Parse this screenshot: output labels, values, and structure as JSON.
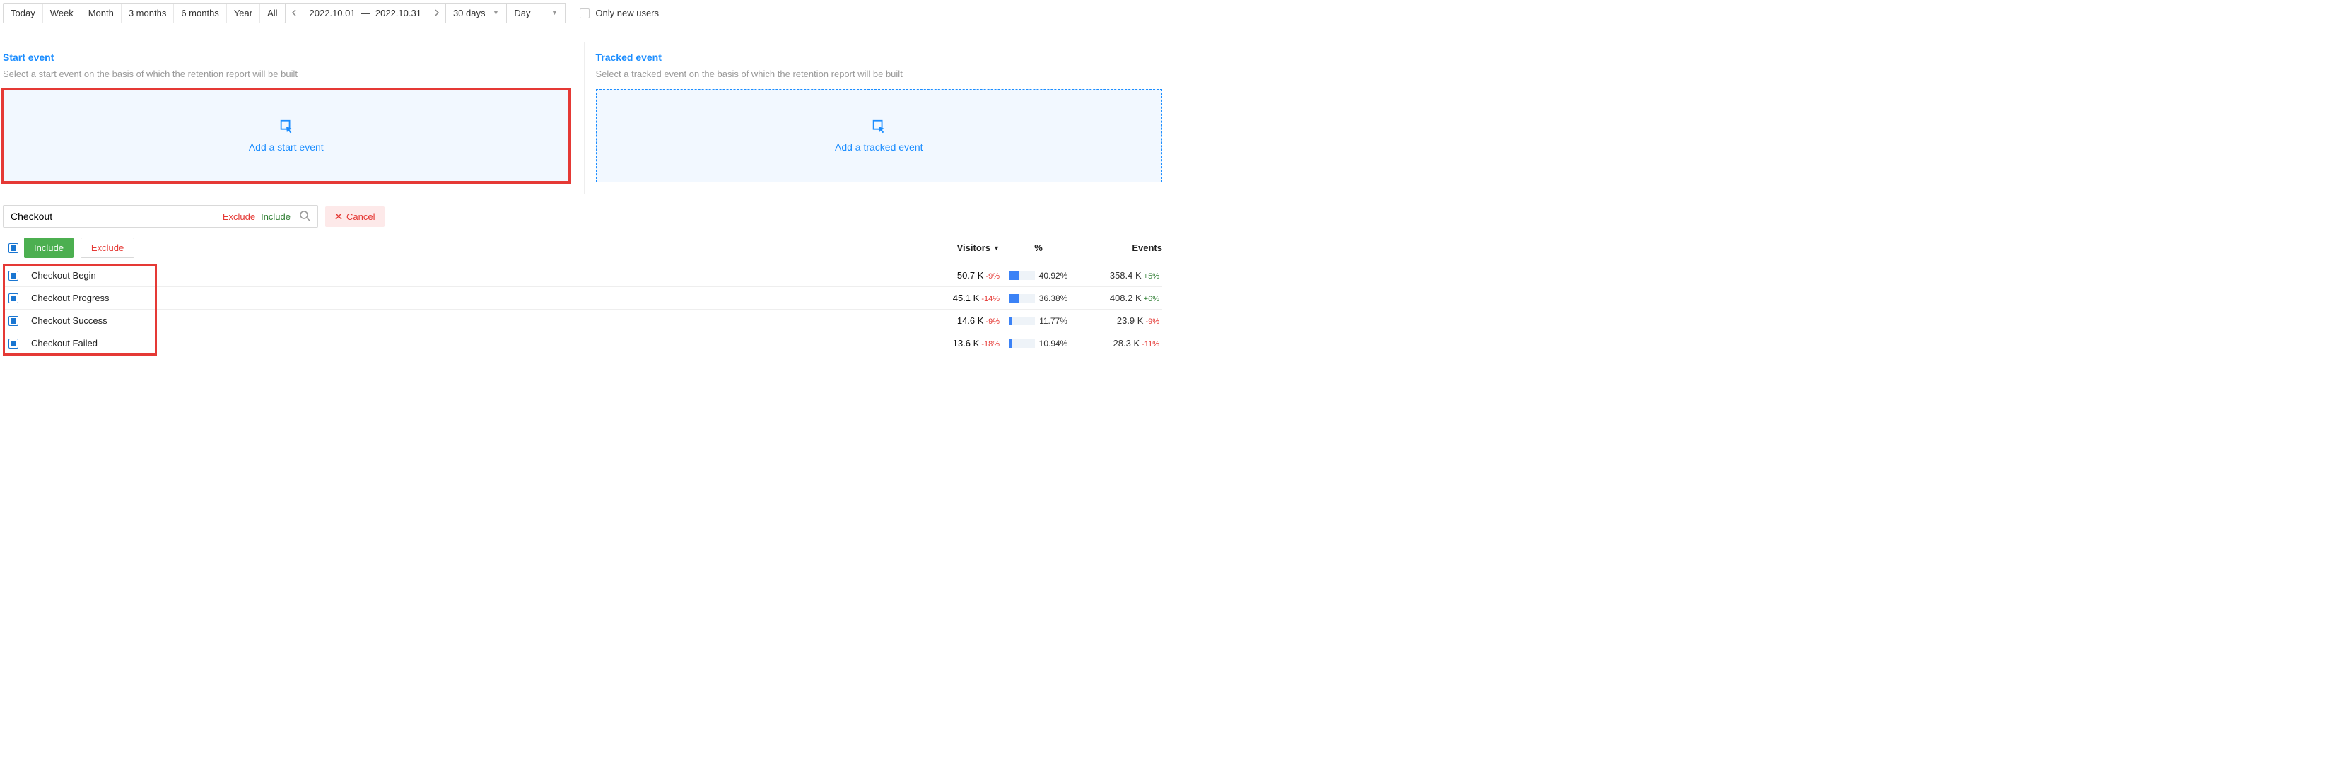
{
  "toolbar": {
    "periods": [
      "Today",
      "Week",
      "Month",
      "3 months",
      "6 months",
      "Year",
      "All"
    ],
    "date_from": "2022.10.01",
    "date_to": "2022.10.31",
    "duration": "30 days",
    "granularity": "Day",
    "only_new_users": "Only new users"
  },
  "panels": {
    "start": {
      "title": "Start event",
      "subtitle": "Select a start event on the basis of which the retention report will be built",
      "add_label": "Add a start event"
    },
    "tracked": {
      "title": "Tracked event",
      "subtitle": "Select a tracked event on the basis of which the retention report will be built",
      "add_label": "Add a tracked event"
    }
  },
  "filter": {
    "query": "Checkout",
    "exclude": "Exclude",
    "include": "Include",
    "cancel": "Cancel"
  },
  "table": {
    "include_btn": "Include",
    "exclude_btn": "Exclude",
    "cols": {
      "visitors": "Visitors",
      "percent": "%",
      "events": "Events"
    },
    "rows": [
      {
        "name": "Checkout Begin",
        "visitors": "50.7 K",
        "v_delta": "-9%",
        "percent": "40.92%",
        "bar": 41,
        "events": "358.4 K",
        "e_delta": "+5%",
        "e_sign": "pos"
      },
      {
        "name": "Checkout Progress",
        "visitors": "45.1 K",
        "v_delta": "-14%",
        "percent": "36.38%",
        "bar": 36,
        "events": "408.2 K",
        "e_delta": "+6%",
        "e_sign": "pos"
      },
      {
        "name": "Checkout Success",
        "visitors": "14.6 K",
        "v_delta": "-9%",
        "percent": "11.77%",
        "bar": 12,
        "events": "23.9 K",
        "e_delta": "-9%",
        "e_sign": "neg"
      },
      {
        "name": "Checkout Failed",
        "visitors": "13.6 K",
        "v_delta": "-18%",
        "percent": "10.94%",
        "bar": 11,
        "events": "28.3 K",
        "e_delta": "-11%",
        "e_sign": "neg"
      }
    ]
  }
}
